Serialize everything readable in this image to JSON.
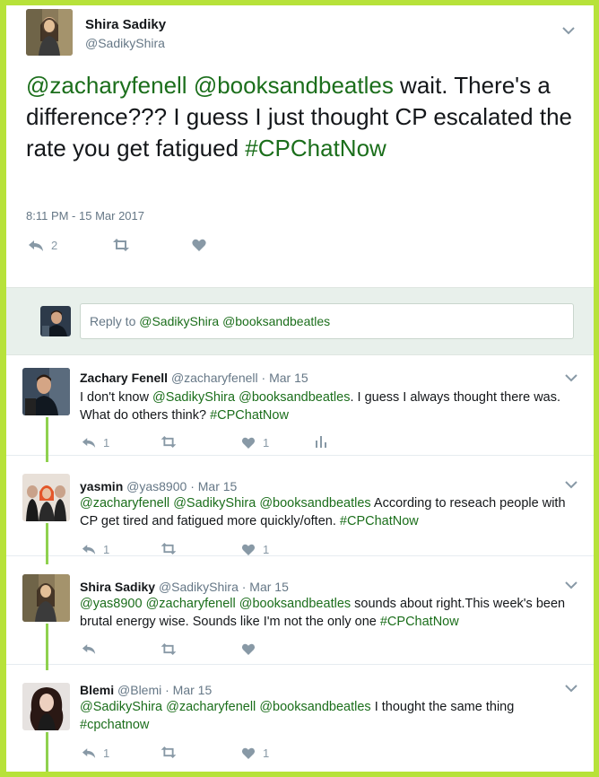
{
  "main_tweet": {
    "name": "Shira Sadiky",
    "handle": "@SadikyShira",
    "mention1": "@zacharyfenell",
    "mention2": "@booksandbeatles",
    "text1": " wait. There's a difference??? I guess I just thought CP escalated the rate you get fatigued ",
    "hashtag": "#CPChatNow",
    "timestamp": "8:11 PM - 15 Mar 2017",
    "reply_count": "2"
  },
  "reply_box": {
    "prefix": "Reply to ",
    "mention1": "@SadikyShira",
    "mention2": "@booksandbeatles"
  },
  "replies": [
    {
      "name": "Zachary Fenell",
      "handle": "@zacharyfenell",
      "date": "· Mar 15",
      "pre": "I don't know ",
      "m1": "@SadikyShira",
      "m2": "@booksandbeatles",
      "m3": "",
      "body": ". I guess I always thought there was. What do others think? ",
      "tag": "#CPChatNow",
      "replies": "1",
      "likes": "1"
    },
    {
      "name": "yasmin",
      "handle": "@yas8900",
      "date": "· Mar 15",
      "pre": "",
      "m1": "@zacharyfenell",
      "m2": "@SadikyShira",
      "m3": "@booksandbeatles",
      "body": " According to reseach people with CP get tired and fatigued more quickly/often. ",
      "tag": "#CPChatNow",
      "replies": "1",
      "likes": "1"
    },
    {
      "name": "Shira Sadiky",
      "handle": "@SadikyShira",
      "date": "· Mar 15",
      "pre": "",
      "m1": "@yas8900",
      "m2": "@zacharyfenell",
      "m3": "@booksandbeatles",
      "body": " sounds about right.This week's been brutal energy wise. Sounds like I'm not the only one ",
      "tag": "#CPChatNow",
      "replies": "",
      "likes": ""
    },
    {
      "name": "Blemi",
      "handle": "@Blemi",
      "date": "· Mar 15",
      "pre": "",
      "m1": "@SadikyShira",
      "m2": "@zacharyfenell",
      "m3": "@booksandbeatles",
      "body": " I thought the same thing ",
      "tag": "#cpchatnow",
      "replies": "1",
      "likes": "1"
    }
  ],
  "colors": {
    "frame_border": "#b7e23a",
    "link_green": "#1b6e1b",
    "thread_line": "#8fd14f"
  },
  "icons": [
    "reply-icon",
    "retweet-icon",
    "heart-icon",
    "analytics-icon",
    "chevron-down-icon"
  ]
}
